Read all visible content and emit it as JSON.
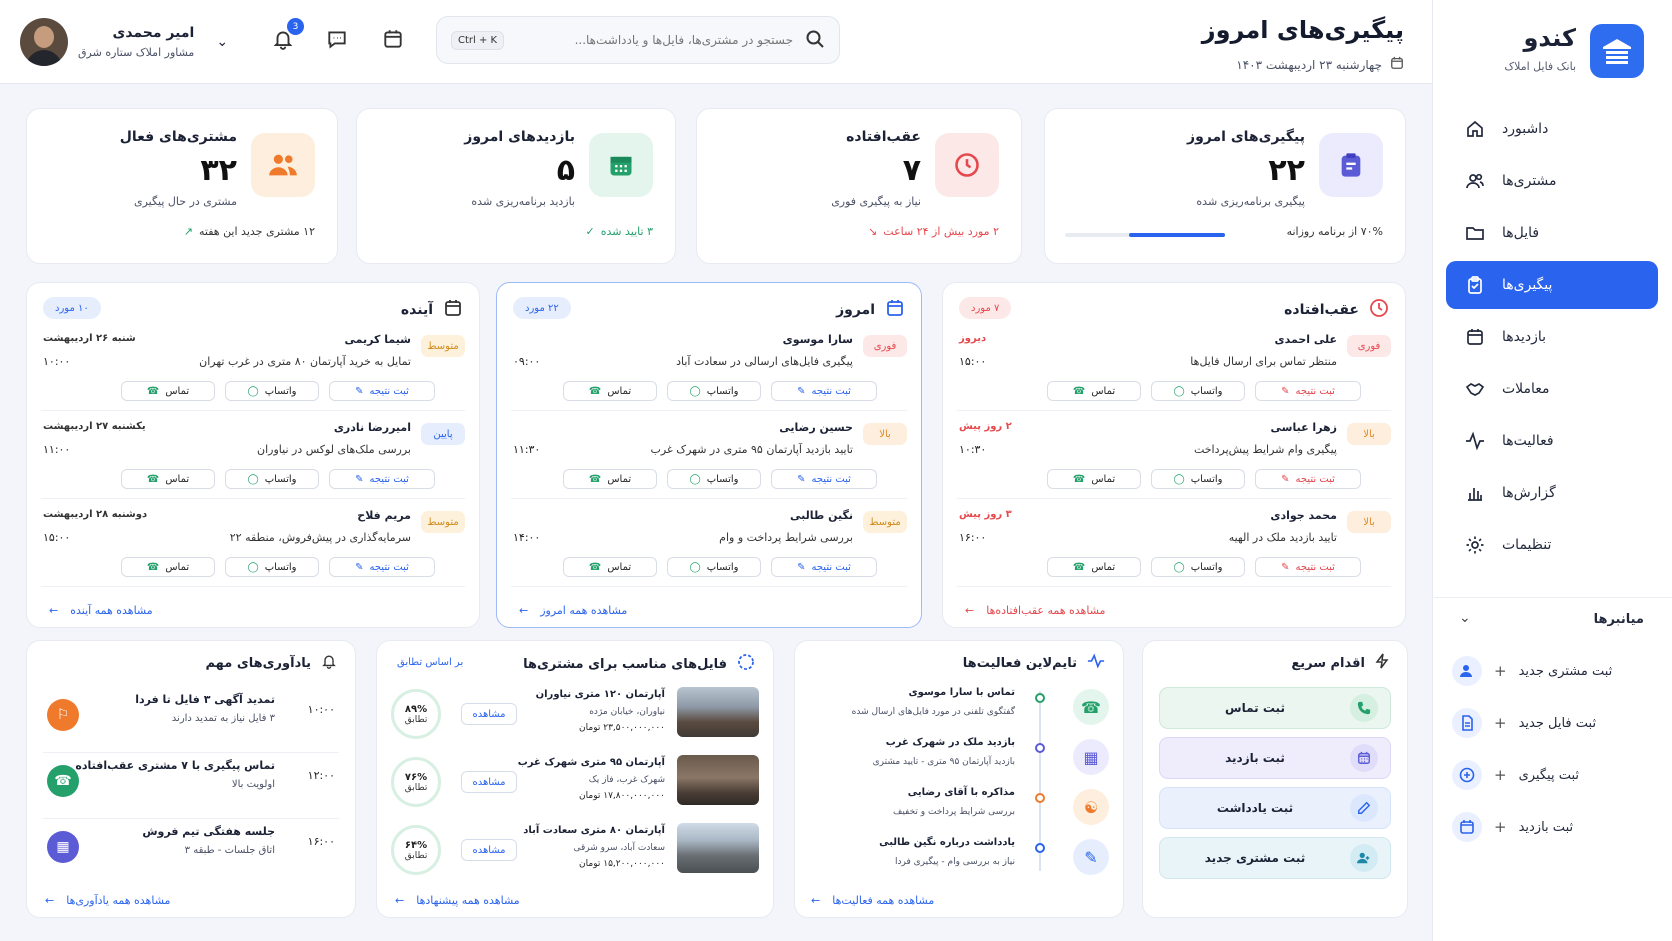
{
  "brand": {
    "name": "کندو",
    "subtitle": "بانک فایل املاک"
  },
  "nav": [
    {
      "label": "داشبورد",
      "icon": "home-icon"
    },
    {
      "label": "مشتری‌ها",
      "icon": "users-icon"
    },
    {
      "label": "فایل‌ها",
      "icon": "folder-icon"
    },
    {
      "label": "پیگیری‌ها",
      "icon": "clipboard-icon",
      "active": true
    },
    {
      "label": "بازدیدها",
      "icon": "calendar-icon"
    },
    {
      "label": "معاملات",
      "icon": "handshake-icon"
    },
    {
      "label": "فعالیت‌ها",
      "icon": "activity-icon"
    },
    {
      "label": "گزارش‌ها",
      "icon": "bar-chart-icon"
    },
    {
      "label": "تنظیمات",
      "icon": "gear-icon"
    }
  ],
  "shortcuts": {
    "title": "میانبرها",
    "items": [
      {
        "label": "ثبت مشتری جدید",
        "plus": "+"
      },
      {
        "label": "ثبت فایل جدید",
        "plus": "+"
      },
      {
        "label": "ثبت پیگیری",
        "plus": "+"
      },
      {
        "label": "ثبت بازدید",
        "plus": "+"
      }
    ]
  },
  "header": {
    "title": "پیگیری‌های امروز",
    "date": "چهارشنبه ۲۳ اردیبهشت ۱۴۰۳",
    "search_placeholder": "جستجو در مشتری‌ها، فایل‌ها و یادداشت‌ها...",
    "shortcut": "Ctrl + K",
    "notifications": "3"
  },
  "user": {
    "name": "امیر محمدی",
    "role": "مشاور املاک ستاره شرق"
  },
  "stats": [
    {
      "title": "پیگیری‌های امروز",
      "value": "۲۲",
      "sub": "پیگیری برنامه‌ریزی شده",
      "foot": "۷۰% از برنامه روزانه",
      "progress": 0.6,
      "color": "#5b5bd6",
      "bg": "#ecebfd"
    },
    {
      "title": "عقب‌افتاده",
      "value": "۷",
      "sub": "نیاز به پیگیری فوری",
      "foot": "۲ مورد بیش از ۲۴ ساعت",
      "color": "#e5484d",
      "bg": "#fde8e8"
    },
    {
      "title": "بازدیدهای امروز",
      "value": "۵",
      "sub": "بازدید برنامه‌ریزی شده",
      "foot": "۳ تایید شده",
      "color": "#24a06b",
      "bg": "#e3f5ec"
    },
    {
      "title": "مشتری‌های فعال",
      "value": "۳۲",
      "sub": "مشتری در حال پیگیری",
      "foot": "۱۲ مشتری جدید این هفته",
      "color": "#f07a2b",
      "bg": "#fdeedd"
    }
  ],
  "actions": {
    "call": "تماس",
    "whatsapp": "واتساپ",
    "result": "ثبت نتیجه"
  },
  "columns": [
    {
      "title": "عقب‌افتاده",
      "count": "۷ مورد",
      "link": "مشاهده همه عقب‌افتاده‌ها",
      "accent": "#e5484d",
      "tasks": [
        {
          "name": "علی احمدی",
          "desc": "منتظر تماس برای ارسال فایل‌ها",
          "when": "دیروز",
          "time": "۱۵:۰۰",
          "prio": "فوری"
        },
        {
          "name": "زهرا عباسی",
          "desc": "پیگیری وام شرایط پیش‌پرداخت",
          "when": "۲ روز پیش",
          "time": "۱۰:۳۰",
          "prio": "بالا"
        },
        {
          "name": "محمد جوادی",
          "desc": "تایید بازدید ملک در الهیه",
          "when": "۳ روز پیش",
          "time": "۱۶:۰۰",
          "prio": "بالا"
        }
      ]
    },
    {
      "title": "امروز",
      "count": "۲۲ مورد",
      "link": "مشاهده همه امروز",
      "accent": "#2a63ee",
      "tasks": [
        {
          "name": "سارا موسوی",
          "desc": "پیگیری فایل‌های ارسالی در سعادت آباد",
          "when": "",
          "time": "۰۹:۰۰",
          "prio": "فوری"
        },
        {
          "name": "حسین رضایی",
          "desc": "تایید بازدید آپارتمان ۹۵ متری در شهرک غرب",
          "when": "",
          "time": "۱۱:۳۰",
          "prio": "بالا"
        },
        {
          "name": "نگین طالبی",
          "desc": "بررسی شرایط پرداخت و وام",
          "when": "",
          "time": "۱۴:۰۰",
          "prio": "متوسط"
        }
      ]
    },
    {
      "title": "آینده",
      "count": "۱۰ مورد",
      "link": "مشاهده همه آینده",
      "accent": "#2a63ee",
      "tasks": [
        {
          "name": "شیما کریمی",
          "desc": "تمایل به خرید آپارتمان ۸۰ متری در غرب تهران",
          "when": "شنبه ۲۶ اردیبهشت",
          "time": "۱۰:۰۰",
          "prio": "متوسط"
        },
        {
          "name": "امیررضا نادری",
          "desc": "بررسی ملک‌های لوکس در نیاوران",
          "when": "یکشنبه ۲۷ اردیبهشت",
          "time": "۱۱:۰۰",
          "prio": "پایین"
        },
        {
          "name": "مریم فلاح",
          "desc": "سرمایه‌گذاری در پیش‌فروش، منطقه ۲۲",
          "when": "دوشنبه ۲۸ اردیبهشت",
          "time": "۱۵:۰۰",
          "prio": "متوسط"
        }
      ]
    }
  ],
  "quick": {
    "title": "اقدام سریع",
    "items": [
      {
        "label": "ثبت تماس",
        "bg": "#eaf6ef",
        "bd": "#cfe9da",
        "ic": "#24a06b",
        "icbg": "#d5efe0"
      },
      {
        "label": "ثبت بازدید",
        "bg": "#efedfc",
        "bd": "#dcd8f7",
        "ic": "#5b5bd6",
        "icbg": "#e0ddfa"
      },
      {
        "label": "ثبت یادداشت",
        "bg": "#eaf1fd",
        "bd": "#d5e3fb",
        "ic": "#2a63ee",
        "icbg": "#dbe7fd"
      },
      {
        "label": "ثبت مشتری جدید",
        "bg": "#e8f4f8",
        "bd": "#d0e8f0",
        "ic": "#1e88a8",
        "icbg": "#d3ebf3"
      }
    ]
  },
  "timeline": {
    "title": "تایم‌لاین فعالیت‌ها",
    "link": "مشاهده همه فعالیت‌ها",
    "items": [
      {
        "title": "تماس با سارا موسوی",
        "sub": "گفتگوی تلفنی در مورد فایل‌های ارسال شده",
        "color": "#24a06b",
        "bg": "#e3f5ec"
      },
      {
        "title": "بازدید ملک در شهرک غرب",
        "sub": "بازدید آپارتمان ۹۵ متری - تایید مشتری",
        "color": "#5b5bd6",
        "bg": "#ecebfd"
      },
      {
        "title": "مذاکره با آقای رضایی",
        "sub": "بررسی شرایط پرداخت و تخفیف",
        "color": "#f07a2b",
        "bg": "#fdeedd"
      },
      {
        "title": "یادداشت درباره نگین طالبی",
        "sub": "نیاز به بررسی وام - پیگیری فردا",
        "color": "#2a63ee",
        "bg": "#e6eefd"
      }
    ]
  },
  "properties": {
    "title": "فایل‌های مناسب برای مشتری‌ها",
    "basis": "بر اساس تطابق",
    "link": "مشاهده همه پیشنهادها",
    "view": "مشاهده",
    "match_label": "تطابق",
    "items": [
      {
        "title": "آپارتمان ۱۲۰ متری نیاوران",
        "loc": "نیاوران، خیابان مژده",
        "price": "۲۳,۵۰۰,۰۰۰,۰۰۰ تومان",
        "match": "۸۹%"
      },
      {
        "title": "آپارتمان ۹۵ متری شهرک غرب",
        "loc": "شهرک غرب، فاز یک",
        "price": "۱۷,۸۰۰,۰۰۰,۰۰۰ تومان",
        "match": "۷۶%"
      },
      {
        "title": "آپارتمان ۸۰ متری سعادت آباد",
        "loc": "سعادت آباد، سرو شرقی",
        "price": "۱۵,۲۰۰,۰۰۰,۰۰۰ تومان",
        "match": "۶۴%"
      }
    ]
  },
  "reminders": {
    "title": "یادآوری‌های مهم",
    "link": "مشاهده همه یادآوری‌ها",
    "items": [
      {
        "time": "۱۰:۰۰",
        "title": "تمدید آگهی ۳ فایل تا فردا",
        "sub": "۳ فایل نیاز به تمدید دارند",
        "color": "#f07a2b"
      },
      {
        "time": "۱۲:۰۰",
        "title": "تماس پیگیری با ۷ مشتری عقب‌افتاده",
        "sub": "اولویت بالا",
        "color": "#24a06b"
      },
      {
        "time": "۱۶:۰۰",
        "title": "جلسه هفتگی تیم فروش",
        "sub": "اتاق جلسات - طبقه ۳",
        "color": "#5b5bd6"
      }
    ]
  }
}
